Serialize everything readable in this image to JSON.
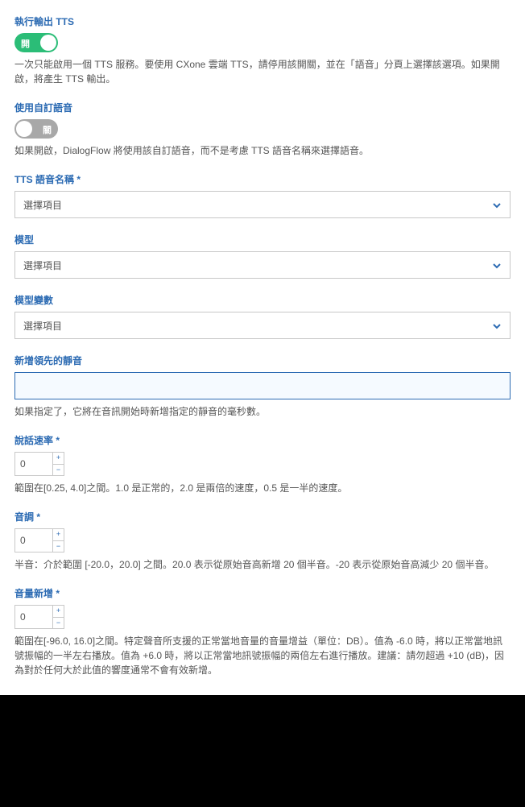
{
  "toggle": {
    "on_label": "開",
    "off_label": "關"
  },
  "tts_output": {
    "label": "執行輸出 TTS",
    "state": "on",
    "help": "一次只能啟用一個 TTS 服務。要使用 CXone 雲端 TTS，請停用該開關，並在「語音」分頁上選擇該選項。如果開啟，將產生 TTS 輸出。"
  },
  "custom_voice": {
    "label": "使用自訂語音",
    "state": "off",
    "help": "如果開啟，DialogFlow 將使用該自訂語音，而不是考慮 TTS 語音名稱來選擇語音。"
  },
  "voice_name": {
    "label": "TTS 語音名稱 *",
    "placeholder": "選擇項目"
  },
  "model": {
    "label": "模型",
    "placeholder": "選擇項目"
  },
  "model_variant": {
    "label": "模型變數",
    "placeholder": "選擇項目"
  },
  "leading_silence": {
    "label": "新增領先的靜音",
    "value": "",
    "help": "如果指定了，它將在音訊開始時新增指定的靜音的毫秒數。"
  },
  "speaking_rate": {
    "label": "說話速率 *",
    "value": "0",
    "help": "範圍在[0.25, 4.0]之間。1.0 是正常的，2.0 是兩倍的速度，0.5 是一半的速度。"
  },
  "pitch": {
    "label": "音調 *",
    "value": "0",
    "help": "半音：介於範圍 [-20.0，20.0] 之間。20.0 表示從原始音高新增 20 個半音。-20 表示從原始音高減少 20 個半音。"
  },
  "volume_gain": {
    "label": "音量新增 *",
    "value": "0",
    "help": "範圍在[-96.0, 16.0]之間。特定聲音所支援的正常當地音量的音量增益（單位：DB）。值為 -6.0 時，將以正常當地訊號振幅的一半左右播放。值為 +6.0 時，將以正常當地訊號振幅的兩倍左右進行播放。建議：請勿超過 +10 (dB)，因為對於任何大於此值的響度通常不會有效新增。"
  }
}
